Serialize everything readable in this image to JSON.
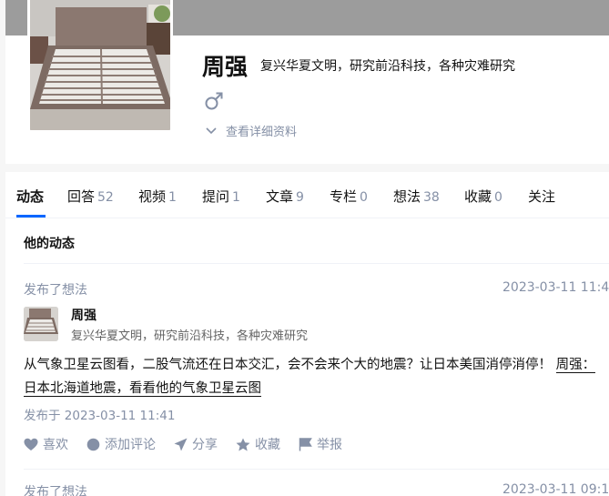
{
  "profile": {
    "name": "周强",
    "headline": "复兴华夏文明，研究前沿科技，各种灾难研究",
    "gender_symbol": "♂",
    "detail_link": "查看详细资料"
  },
  "tabs": [
    {
      "label": "动态",
      "count": ""
    },
    {
      "label": "回答",
      "count": "52"
    },
    {
      "label": "视频",
      "count": "1"
    },
    {
      "label": "提问",
      "count": "1"
    },
    {
      "label": "文章",
      "count": "9"
    },
    {
      "label": "专栏",
      "count": "0"
    },
    {
      "label": "想法",
      "count": "38"
    },
    {
      "label": "收藏",
      "count": "0"
    },
    {
      "label": "关注",
      "count": ""
    }
  ],
  "section_title": "他的动态",
  "feed": [
    {
      "type": "发布了想法",
      "time": "2023-03-11 11:4",
      "author_name": "周强",
      "author_headline": "复兴华夏文明，研究前沿科技，各种灾难研究",
      "content": "从气象卫星云图看，二股气流还在日本交汇，会不会来个大的地震？让日本美国消停消停！",
      "link_text_1": "周强：",
      "link_text_2": "日本北海道地震，看看他的气象卫星云图",
      "publish_time": "发布于 2023-03-11 11:41",
      "actions": {
        "like": "喜欢",
        "comment": "添加评论",
        "share": "分享",
        "favorite": "收藏",
        "report": "举报"
      }
    },
    {
      "type": "发布了想法",
      "time": "2023-03-11 09:1"
    }
  ],
  "colors": {
    "accent": "#0066ff",
    "muted": "#8590a6",
    "cover": "#9c9c9c"
  }
}
